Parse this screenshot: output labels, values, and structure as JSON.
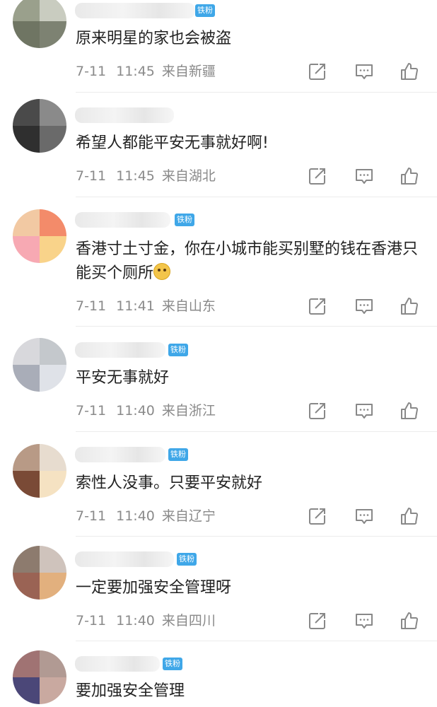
{
  "badge_label": "铁粉",
  "comments": [
    {
      "text": "原来明星的家也会被盗",
      "date": "7-11",
      "time": "11:45",
      "location": "来自新疆",
      "avatar": [
        "#9aa08c",
        "#c9ccc0",
        "#6f7563",
        "#7d8272"
      ],
      "has_badge": true,
      "has_emoji": false
    },
    {
      "text": "希望人都能平安无事就好啊!",
      "date": "7-11",
      "time": "11:45",
      "location": "来自湖北",
      "avatar": [
        "#4a4a4a",
        "#8a8a8a",
        "#2f2f2f",
        "#6a6a6a"
      ],
      "has_badge": false,
      "has_emoji": false
    },
    {
      "text": "香港寸土寸金，你在小城市能买别墅的钱在香港只能买个厕所",
      "date": "7-11",
      "time": "11:41",
      "location": "来自山东",
      "avatar": [
        "#f2c9a3",
        "#f38b6a",
        "#f7a9b3",
        "#f9d38a"
      ],
      "has_badge": true,
      "has_emoji": true
    },
    {
      "text": "平安无事就好",
      "date": "7-11",
      "time": "11:40",
      "location": "来自浙江",
      "avatar": [
        "#d8d8dc",
        "#c4c8cc",
        "#a9adb8",
        "#dfe2e8"
      ],
      "has_badge": true,
      "has_emoji": false
    },
    {
      "text": "索性人没事。只要平安就好",
      "date": "7-11",
      "time": "11:40",
      "location": "来自辽宁",
      "avatar": [
        "#b89a86",
        "#e7dccf",
        "#7a4a36",
        "#f5e2c2"
      ],
      "has_badge": true,
      "has_emoji": false
    },
    {
      "text": "一定要加强安全管理呀",
      "date": "7-11",
      "time": "11:40",
      "location": "来自四川",
      "avatar": [
        "#8d7b6e",
        "#cfc3bc",
        "#9a6354",
        "#e2b07e"
      ],
      "has_badge": true,
      "has_emoji": false
    },
    {
      "text": "要加强安全管理",
      "date": "",
      "time": "",
      "location": "",
      "avatar": [
        "#a07373",
        "#b19a93",
        "#4b4778",
        "#c9a9a0"
      ],
      "has_badge": true,
      "has_emoji": false
    }
  ]
}
